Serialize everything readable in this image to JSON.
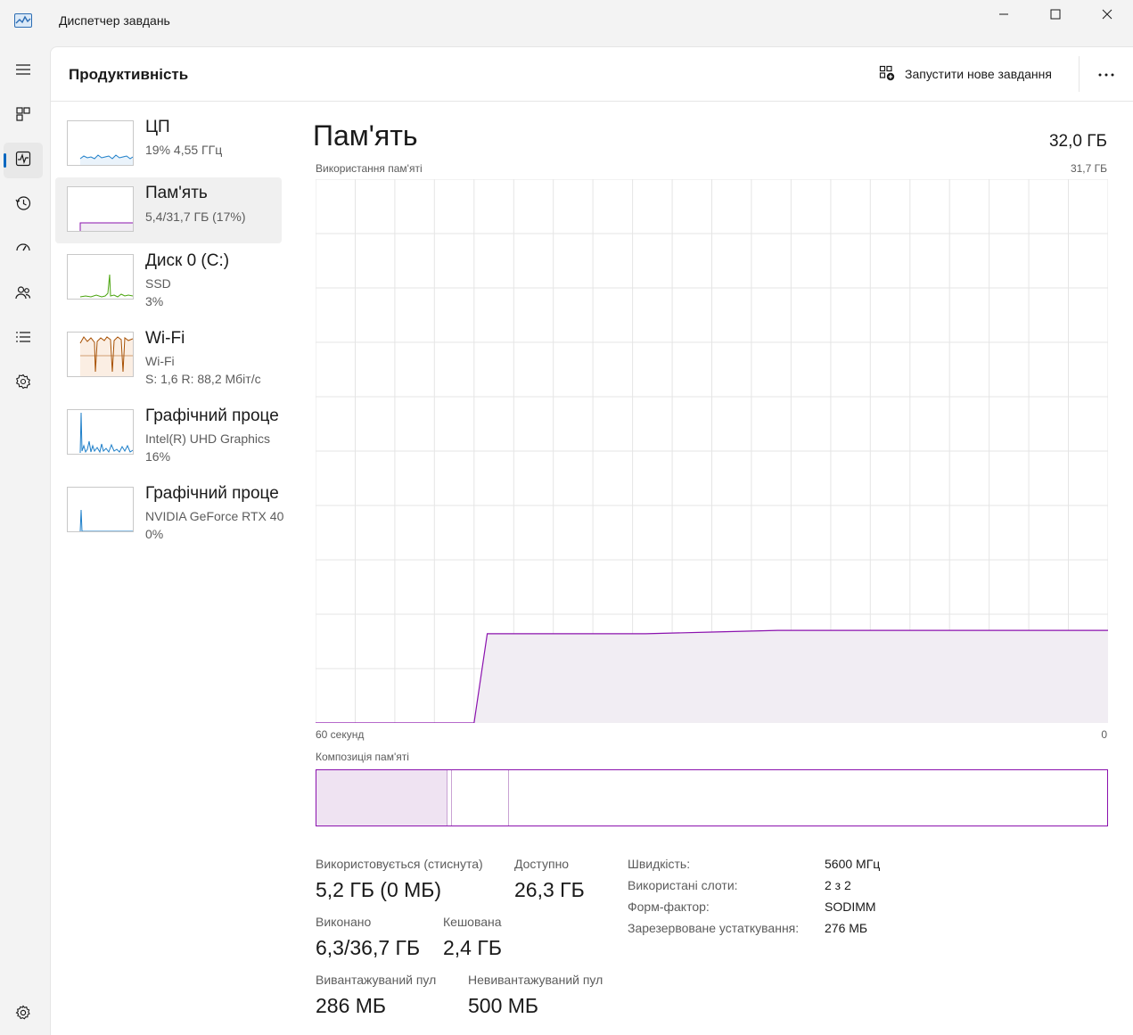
{
  "window": {
    "title": "Диспетчер завдань",
    "icon": "task-manager-icon"
  },
  "rail": {
    "items": [
      {
        "name": "menu-icon"
      },
      {
        "name": "processes-icon"
      },
      {
        "name": "performance-icon",
        "active": true
      },
      {
        "name": "app-history-icon"
      },
      {
        "name": "startup-apps-icon"
      },
      {
        "name": "users-icon"
      },
      {
        "name": "details-icon"
      },
      {
        "name": "services-icon"
      },
      {
        "name": "settings-icon"
      }
    ],
    "accent": "#0067c0"
  },
  "header": {
    "title": "Продуктивність",
    "run_task_label": "Запустити нове завдання",
    "more_icon": "more-icon"
  },
  "devices": [
    {
      "name": "ЦП",
      "line1": "19%  4,55 ГГц",
      "line2": "",
      "color": "#1e7fc9"
    },
    {
      "name": "Пам'ять",
      "line1": "5,4/31,7 ГБ (17%)",
      "line2": "",
      "color": "#8b12ae",
      "selected": true
    },
    {
      "name": "Диск 0 (C:)",
      "line1": "SSD",
      "line2": "3%",
      "color": "#4aa40e"
    },
    {
      "name": "Wi-Fi",
      "line1": "Wi-Fi",
      "line2": "S: 1,6  R: 88,2 Мбіт/с",
      "color": "#a74f01"
    },
    {
      "name": "Графічний проце",
      "line1": "Intel(R) UHD Graphics",
      "line2": "16%",
      "color": "#1e7fc9"
    },
    {
      "name": "Графічний проце",
      "line1": "NVIDIA GeForce RTX 40",
      "line2": "0%",
      "color": "#1e7fc9"
    }
  ],
  "memory": {
    "title": "Пам'ять",
    "total": "32,0 ГБ",
    "usage_label": "Використання пам'яті",
    "usage_max": "31,7 ГБ",
    "x_left": "60 секунд",
    "x_right": "0",
    "composition_label": "Композиція пам'яті",
    "in_use_label": "Використовується (стиснута)",
    "in_use_value": "5,2 ГБ (0 МБ)",
    "available_label": "Доступно",
    "available_value": "26,3 ГБ",
    "committed_label": "Виконано",
    "committed_value": "6,3/36,7 ГБ",
    "cached_label": "Кешована",
    "cached_value": "2,4 ГБ",
    "paged_label": "Вивантажуваний пул",
    "paged_value": "286 МБ",
    "nonpaged_label": "Невивантажуваний пул",
    "nonpaged_value": "500 МБ",
    "specs": [
      {
        "key": "Швидкість:",
        "value": "5600 МГц"
      },
      {
        "key": "Використані слоти:",
        "value": "2 з 2"
      },
      {
        "key": "Форм-фактор:",
        "value": "SODIMM"
      },
      {
        "key": "Зарезервоване устаткування:",
        "value": "276 МБ"
      }
    ],
    "colors": {
      "line": "#8b12ae",
      "fill": "#f1edf3",
      "grid": "#e5e5e5",
      "comp_used": "#efe3f2"
    }
  },
  "chart_data": {
    "type": "area",
    "title": "Використання пам'яті",
    "x": [
      -60,
      -48,
      -47,
      -45,
      -40,
      -35,
      -30,
      -25,
      -20,
      -15,
      -14,
      -12,
      -11,
      -10,
      -7,
      -6,
      -5,
      0
    ],
    "xlabel": "",
    "ylabel": "",
    "xlim": [
      -60,
      0
    ],
    "ylim": [
      0,
      31.7
    ],
    "series": [
      {
        "values": [
          0,
          0,
          5.2,
          5.2,
          5.2,
          5.2,
          5.3,
          5.4,
          5.4,
          5.4,
          5.4,
          5.4,
          5.4,
          5.4,
          5.4,
          5.4,
          5.4,
          5.4
        ]
      }
    ],
    "grid": true
  }
}
